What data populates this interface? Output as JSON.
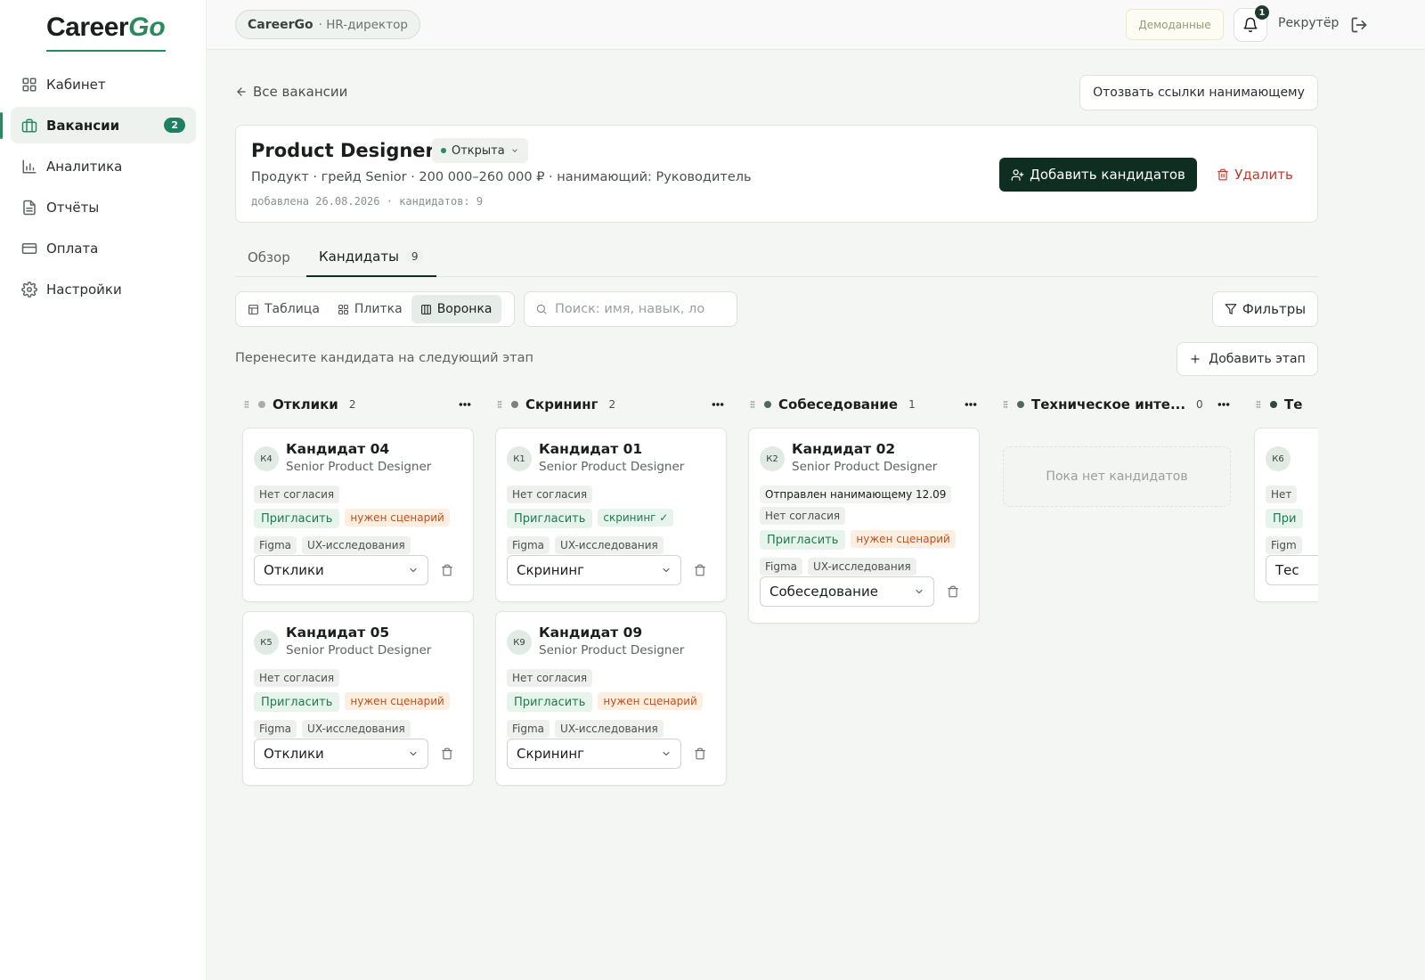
{
  "brand": {
    "name_part1": "Career",
    "name_part2": "Go"
  },
  "sidebar": {
    "items": [
      {
        "label": "Кабинет",
        "icon": "grid-icon"
      },
      {
        "label": "Вакансии",
        "icon": "briefcase-icon",
        "badge": "2",
        "active": true
      },
      {
        "label": "Аналитика",
        "icon": "bar-chart-icon"
      },
      {
        "label": "Отчёты",
        "icon": "document-icon"
      },
      {
        "label": "Оплата",
        "icon": "credit-card-icon"
      },
      {
        "label": "Настройки",
        "icon": "gear-icon"
      }
    ]
  },
  "topbar": {
    "workspace": "CareerGo",
    "role": "· HR-директор",
    "demo_label": "Демоданные",
    "notif_count": "1",
    "user": "Рекрутёр"
  },
  "page": {
    "back_label": "Все вакансии",
    "revoke_label": "Отозвать ссылки нанимающему"
  },
  "vacancy": {
    "title": "Product Designer",
    "status": "Открыта",
    "meta": "Продукт · грейд Senior · 200 000–260 000 ₽ · нанимающий: Руководитель",
    "added": "добавлена 26.08.2026 · кандидатов: 9",
    "add_button": "Добавить кандидатов",
    "delete_button": "Удалить"
  },
  "tabs": {
    "overview": "Обзор",
    "candidates": "Кандидаты",
    "candidates_count": "9"
  },
  "views": {
    "table": "Таблица",
    "tiles": "Плитка",
    "funnel": "Воронка"
  },
  "search": {
    "placeholder": "Поиск: имя, навык, ло",
    "value": ""
  },
  "filters_label": "Фильтры",
  "hint": "Перенесите кандидата на следующий этап",
  "add_stage_label": "Добавить этап",
  "colors": {
    "accent": "#2a8a5e",
    "dark_button": "#0f2e22",
    "danger": "#c0392b"
  },
  "columns": [
    {
      "title": "Отклики",
      "count": "2",
      "dot": "#a8aea9",
      "cards": [
        {
          "initials": "К4",
          "name": "Кандидат 04",
          "role": "Senior Product Designer",
          "consent": "Нет согласия",
          "invite": "Пригласить",
          "tag": "нужен сценарий",
          "tag_kind": "orange",
          "skills": [
            "Figma",
            "UX-исследования"
          ],
          "stage": "Отклики"
        },
        {
          "initials": "К5",
          "name": "Кандидат 05",
          "role": "Senior Product Designer",
          "consent": "Нет согласия",
          "invite": "Пригласить",
          "tag": "нужен сценарий",
          "tag_kind": "orange",
          "skills": [
            "Figma",
            "UX-исследования"
          ],
          "stage": "Отклики"
        }
      ]
    },
    {
      "title": "Скрининг",
      "count": "2",
      "dot": "#7b827d",
      "cards": [
        {
          "initials": "К1",
          "name": "Кандидат 01",
          "role": "Senior Product Designer",
          "consent": "Нет согласия",
          "invite": "Пригласить",
          "tag": "скрининг ✓",
          "tag_kind": "ok",
          "skills": [
            "Figma",
            "UX-исследования"
          ],
          "stage": "Скрининг"
        },
        {
          "initials": "К9",
          "name": "Кандидат 09",
          "role": "Senior Product Designer",
          "consent": "Нет согласия",
          "invite": "Пригласить",
          "tag": "нужен сценарий",
          "tag_kind": "orange",
          "skills": [
            "Figma",
            "UX-исследования"
          ],
          "stage": "Скрининг"
        }
      ]
    },
    {
      "title": "Собеседование",
      "count": "1",
      "dot": "#4e6a5a",
      "cards": [
        {
          "initials": "К2",
          "name": "Кандидат 02",
          "role": "Senior Product Designer",
          "sent": "Отправлен нанимающему 12.09",
          "consent": "Нет согласия",
          "invite": "Пригласить",
          "tag": "нужен сценарий",
          "tag_kind": "orange",
          "skills": [
            "Figma",
            "UX-исследования"
          ],
          "stage": "Собеседование"
        }
      ]
    },
    {
      "title": "Техническое инте...",
      "count": "0",
      "dot": "#4e6a5a",
      "empty": "Пока нет кандидатов",
      "cards": []
    },
    {
      "title": "Те",
      "count": "",
      "dot": "#2f4a3b",
      "cards": [
        {
          "initials": "К6",
          "name": "",
          "role": "",
          "consent": "Нет",
          "invite": "При",
          "tag": "",
          "tag_kind": "",
          "skills": [
            "Figm"
          ],
          "stage": "Тес"
        }
      ]
    }
  ]
}
